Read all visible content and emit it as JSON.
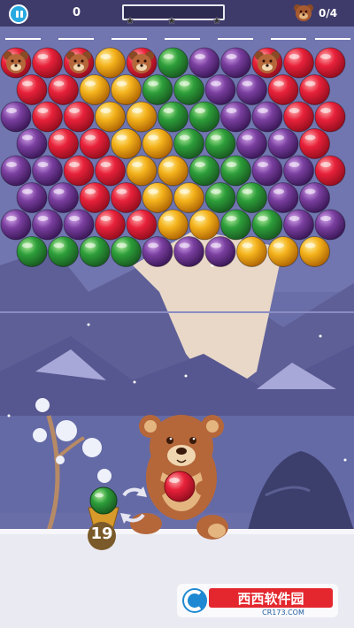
{
  "hud": {
    "score": "0",
    "goal": "0/4",
    "stars_filled": 0,
    "progress_fraction": 0.0
  },
  "shooter": {
    "remaining_shots": "19",
    "current_bubble": "red",
    "next_bubble": "green"
  },
  "watermark": {
    "brand": "西西软件园",
    "site": "CR173.COM"
  },
  "colors": {
    "red": "#e8213a",
    "purple": "#7a3f9f",
    "yellow": "#f4b21b",
    "green": "#2d9e3a",
    "bear": "#b5673a"
  },
  "board": {
    "rows": [
      [
        "B",
        "R",
        "B",
        "Y",
        "B",
        "G",
        "P",
        "P",
        "B",
        "R",
        "R"
      ],
      [
        "R",
        "R",
        "Y",
        "Y",
        "G",
        "G",
        "P",
        "P",
        "R",
        "R",
        "R"
      ],
      [
        "P",
        "R",
        "R",
        "Y",
        "Y",
        "G",
        "G",
        "P",
        "P",
        "R",
        "R"
      ],
      [
        "P",
        "R",
        "R",
        "Y",
        "Y",
        "G",
        "G",
        "P",
        "P",
        "R",
        "R"
      ],
      [
        "P",
        "P",
        "R",
        "R",
        "Y",
        "Y",
        "G",
        "G",
        "P",
        "P",
        "R"
      ],
      [
        "P",
        "P",
        "R",
        "R",
        "Y",
        "Y",
        "G",
        "G",
        "P",
        "P",
        "R"
      ],
      [
        "P",
        "P",
        "P",
        "R",
        "R",
        "Y",
        "Y",
        "G",
        "G",
        "P",
        "P"
      ],
      [
        "G",
        "G",
        "G",
        "G",
        "P",
        "P",
        "P",
        "Y",
        "Y",
        "Y",
        "Y"
      ]
    ]
  }
}
